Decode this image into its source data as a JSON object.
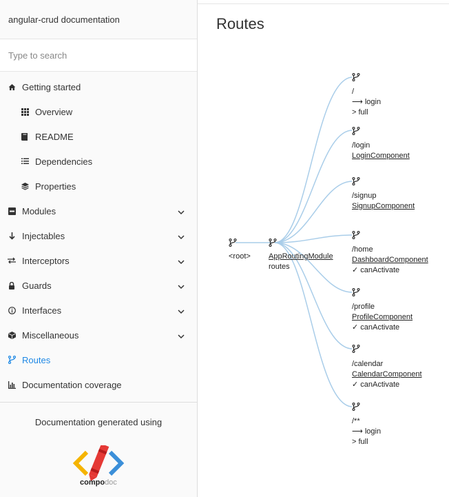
{
  "sidebar": {
    "title": "angular-crud documentation",
    "search_placeholder": "Type to search",
    "items": [
      {
        "label": "Getting started",
        "icon": "home-icon"
      },
      {
        "label": "Overview",
        "icon": "grid-icon"
      },
      {
        "label": "README",
        "icon": "book-icon"
      },
      {
        "label": "Dependencies",
        "icon": "list-icon"
      },
      {
        "label": "Properties",
        "icon": "layers-icon"
      },
      {
        "label": "Modules",
        "icon": "module-icon"
      },
      {
        "label": "Injectables",
        "icon": "arrow-down-icon"
      },
      {
        "label": "Interceptors",
        "icon": "swap-icon"
      },
      {
        "label": "Guards",
        "icon": "lock-icon"
      },
      {
        "label": "Interfaces",
        "icon": "info-icon"
      },
      {
        "label": "Miscellaneous",
        "icon": "cube-icon"
      },
      {
        "label": "Routes",
        "icon": "branch-icon"
      },
      {
        "label": "Documentation coverage",
        "icon": "bar-chart-icon"
      }
    ],
    "footer_text": "Documentation generated using",
    "logo_text_bold": "compo",
    "logo_text_light": "doc",
    "active_color": "#1e88e5"
  },
  "main": {
    "title": "Routes"
  },
  "routes_tree": {
    "root_label": "<root>",
    "module": {
      "name": "AppRoutingModule",
      "sub": "routes"
    },
    "routes": [
      {
        "path": "/",
        "line2": "⟶ login",
        "line3": "> full"
      },
      {
        "path": "/login",
        "component": "LoginComponent"
      },
      {
        "path": "/signup",
        "component": "SignupComponent"
      },
      {
        "path": "/home",
        "component": "DashboardComponent",
        "guard": "✓ canActivate"
      },
      {
        "path": "/profile",
        "component": "ProfileComponent",
        "guard": "✓ canActivate"
      },
      {
        "path": "/calendar",
        "component": "CalendarComponent",
        "guard": "✓ canActivate"
      },
      {
        "path": "/**",
        "line2": "⟶ login",
        "line3": "> full"
      }
    ]
  }
}
